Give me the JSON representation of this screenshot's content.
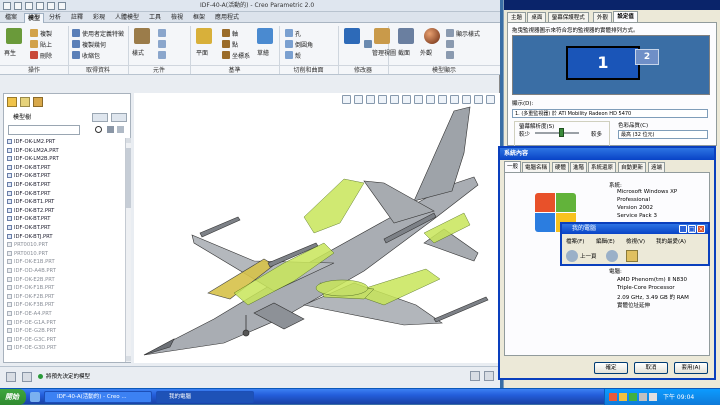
{
  "creo": {
    "title": "IDF-40-A(活動的) - Creo Parametric 2.0",
    "tabs": [
      "檔案",
      "模型",
      "分析",
      "註釋",
      "彩現",
      "人體模型",
      "工具",
      "檢視",
      "框架",
      "應用程式"
    ],
    "active_tab": "模型",
    "ribbon": {
      "regen": "再生",
      "copy": "複製",
      "paste": "貼上",
      "delete": "刪除",
      "use_copy_geo": "使用者定義特徵",
      "copy_geometry": "複製幾何",
      "shrinkwrap": "收縮包",
      "axis": "軸",
      "point": "點",
      "csys": "坐標系",
      "pattern": "樣式",
      "plane": "平面",
      "sketch": "草繪",
      "extrude": "拉伸",
      "revolve": "旋轉",
      "sweep": "掃描",
      "hole": "孔",
      "round": "倒圓角",
      "shell": "殼",
      "datum": "基準",
      "pattern_label": "樣式",
      "mirror": "鏡像",
      "extend": "延伸",
      "appearance": "外觀",
      "manage_views": "管理視圖",
      "section": "截面",
      "display_style": "顯示樣式",
      "groups": [
        "操作",
        "取得資料",
        "元件",
        "基準",
        "切削和曲面",
        "修改器",
        "模型顯示"
      ]
    },
    "model_tree": {
      "title": "模型樹",
      "items": [
        {
          "name": "IDF-OK-LM2.PRT",
          "suppressed": false
        },
        {
          "name": "IDF-OK-LM2A.PRT",
          "suppressed": false
        },
        {
          "name": "IDF-OK-LM2B.PRT",
          "suppressed": false
        },
        {
          "name": "IDF-OK-BT.PRT",
          "suppressed": false
        },
        {
          "name": "IDF-OK-BT.PRT",
          "suppressed": false
        },
        {
          "name": "IDF-OK-BT.PRT",
          "suppressed": false
        },
        {
          "name": "IDF-OK-BT.PRT",
          "suppressed": false
        },
        {
          "name": "IDF-OK-BT1.PRT",
          "suppressed": false
        },
        {
          "name": "IDF-OK-BT2.PRT",
          "suppressed": false
        },
        {
          "name": "IDF-OK-BT.PRT",
          "suppressed": false
        },
        {
          "name": "IDF-OK-BT.PRT",
          "suppressed": false
        },
        {
          "name": "IDF-OK-BTJ.PRT",
          "suppressed": false
        },
        {
          "name": "PRT0010.PRT",
          "suppressed": true
        },
        {
          "name": "PRT0010.PRT",
          "suppressed": true
        },
        {
          "name": "IDF-OK-E1B.PRT",
          "suppressed": true
        },
        {
          "name": "IDF-OD-A4B.PRT",
          "suppressed": true
        },
        {
          "name": "IDF-OK-E2B.PRT",
          "suppressed": true
        },
        {
          "name": "IDF-OK-F1B.PRT",
          "suppressed": true
        },
        {
          "name": "IDF-OK-F2B.PRT",
          "suppressed": true
        },
        {
          "name": "IDF-OK-F3B.PRT",
          "suppressed": true
        },
        {
          "name": "IDF-OE-A4.PRT",
          "suppressed": true
        },
        {
          "name": "IDF-OE-G1A.PRT",
          "suppressed": true
        },
        {
          "name": "IDF-OE-G2B.PRT",
          "suppressed": true
        },
        {
          "name": "IDF-OE-G3C.PRT",
          "suppressed": true
        },
        {
          "name": "IDF-OE-G3D.PRT",
          "suppressed": true
        }
      ]
    },
    "status_text": "將預先決定的模型"
  },
  "display_props": {
    "tabs": [
      "主題",
      "桌面",
      "螢幕保護程式",
      "外觀",
      "設定值"
    ],
    "active_tab": "設定值",
    "instruction": "拖曳監視器圖示來符合您的監視器的實體排列方式。",
    "monitor_primary": "1",
    "monitor_secondary": "2",
    "display_label": "顯示(D):",
    "display_value": "1. (多重監視器) 於 ATI Mobility Radeon HD 5470",
    "resolution_label": "螢幕解析度(S)",
    "resolution_less": "較少",
    "resolution_more": "較多",
    "color_label": "色彩品質(C)",
    "color_value": "最高 (32 位元)"
  },
  "sys_props": {
    "title": "系統內容",
    "tabs": [
      "一般",
      "電腦名稱",
      "硬體",
      "進階",
      "系統還原",
      "自動更新",
      "遠端"
    ],
    "active_tab": "一般",
    "system_label": "系統:",
    "os": "Microsoft Windows XP",
    "edition": "Professional",
    "version": "Version 2002",
    "sp": "Service Pack 3",
    "computer_label": "電腦:",
    "cpu1": "AMD Phenom(tm) II N830",
    "cpu2": "Triple-Core Processor",
    "cpu3": "2.09 GHz, 3.49 GB 的 RAM",
    "pae": "實體位址延伸",
    "ok": "確定",
    "cancel": "取消",
    "apply": "套用(A)"
  },
  "mycomp": {
    "title": "我的電腦",
    "menu": [
      "檔案(F)",
      "編輯(E)",
      "檢視(V)",
      "我的最愛(A)"
    ],
    "back": "上一頁"
  },
  "taskbar": {
    "start": "開始",
    "tasks": [
      "IDF-40-A(活動的) - Creo ...",
      "我的電腦"
    ],
    "active_task": 1,
    "clock": "下午 09:04"
  },
  "colors": {
    "xp_title": "#0843c6",
    "creo_bg": "#e9edf2",
    "highlight": "#c8e65a"
  }
}
